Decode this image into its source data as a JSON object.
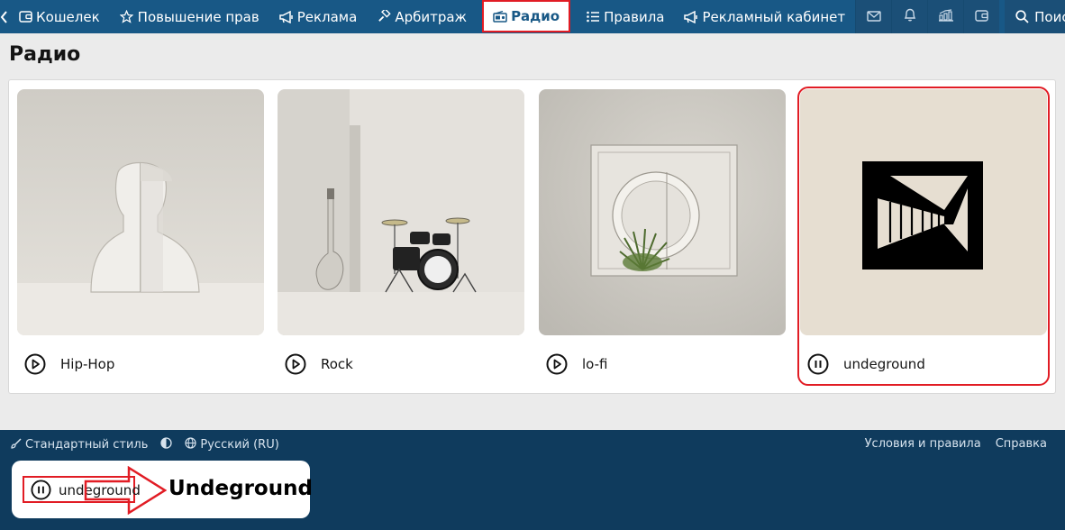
{
  "nav": {
    "items": [
      {
        "label": "Кошелек",
        "icon": "wallet-icon"
      },
      {
        "label": "Повышение прав",
        "icon": "star-icon"
      },
      {
        "label": "Реклама",
        "icon": "megaphone-icon"
      },
      {
        "label": "Арбитраж",
        "icon": "gavel-icon"
      },
      {
        "label": "Радио",
        "icon": "radio-icon"
      },
      {
        "label": "Правила",
        "icon": "list-icon"
      },
      {
        "label": "Рекламный кабинет",
        "icon": "megaphone-icon"
      }
    ],
    "search_label": "Поиск"
  },
  "page": {
    "title": "Радио"
  },
  "stations": [
    {
      "label": "Hip-Hop",
      "state": "paused"
    },
    {
      "label": "Rock",
      "state": "paused"
    },
    {
      "label": "lo-fi",
      "state": "paused"
    },
    {
      "label": "undeground",
      "state": "playing"
    }
  ],
  "footer": {
    "style_label": "Стандартный стиль",
    "language_label": "Русский (RU)",
    "terms_label": "Условия и правила",
    "help_label": "Справка"
  },
  "player": {
    "station_label": "undeground",
    "callout_text": "Undeground"
  },
  "colors": {
    "nav_bg": "#185886",
    "footer_bg": "#0f3b5d",
    "highlight": "#e11c24"
  }
}
